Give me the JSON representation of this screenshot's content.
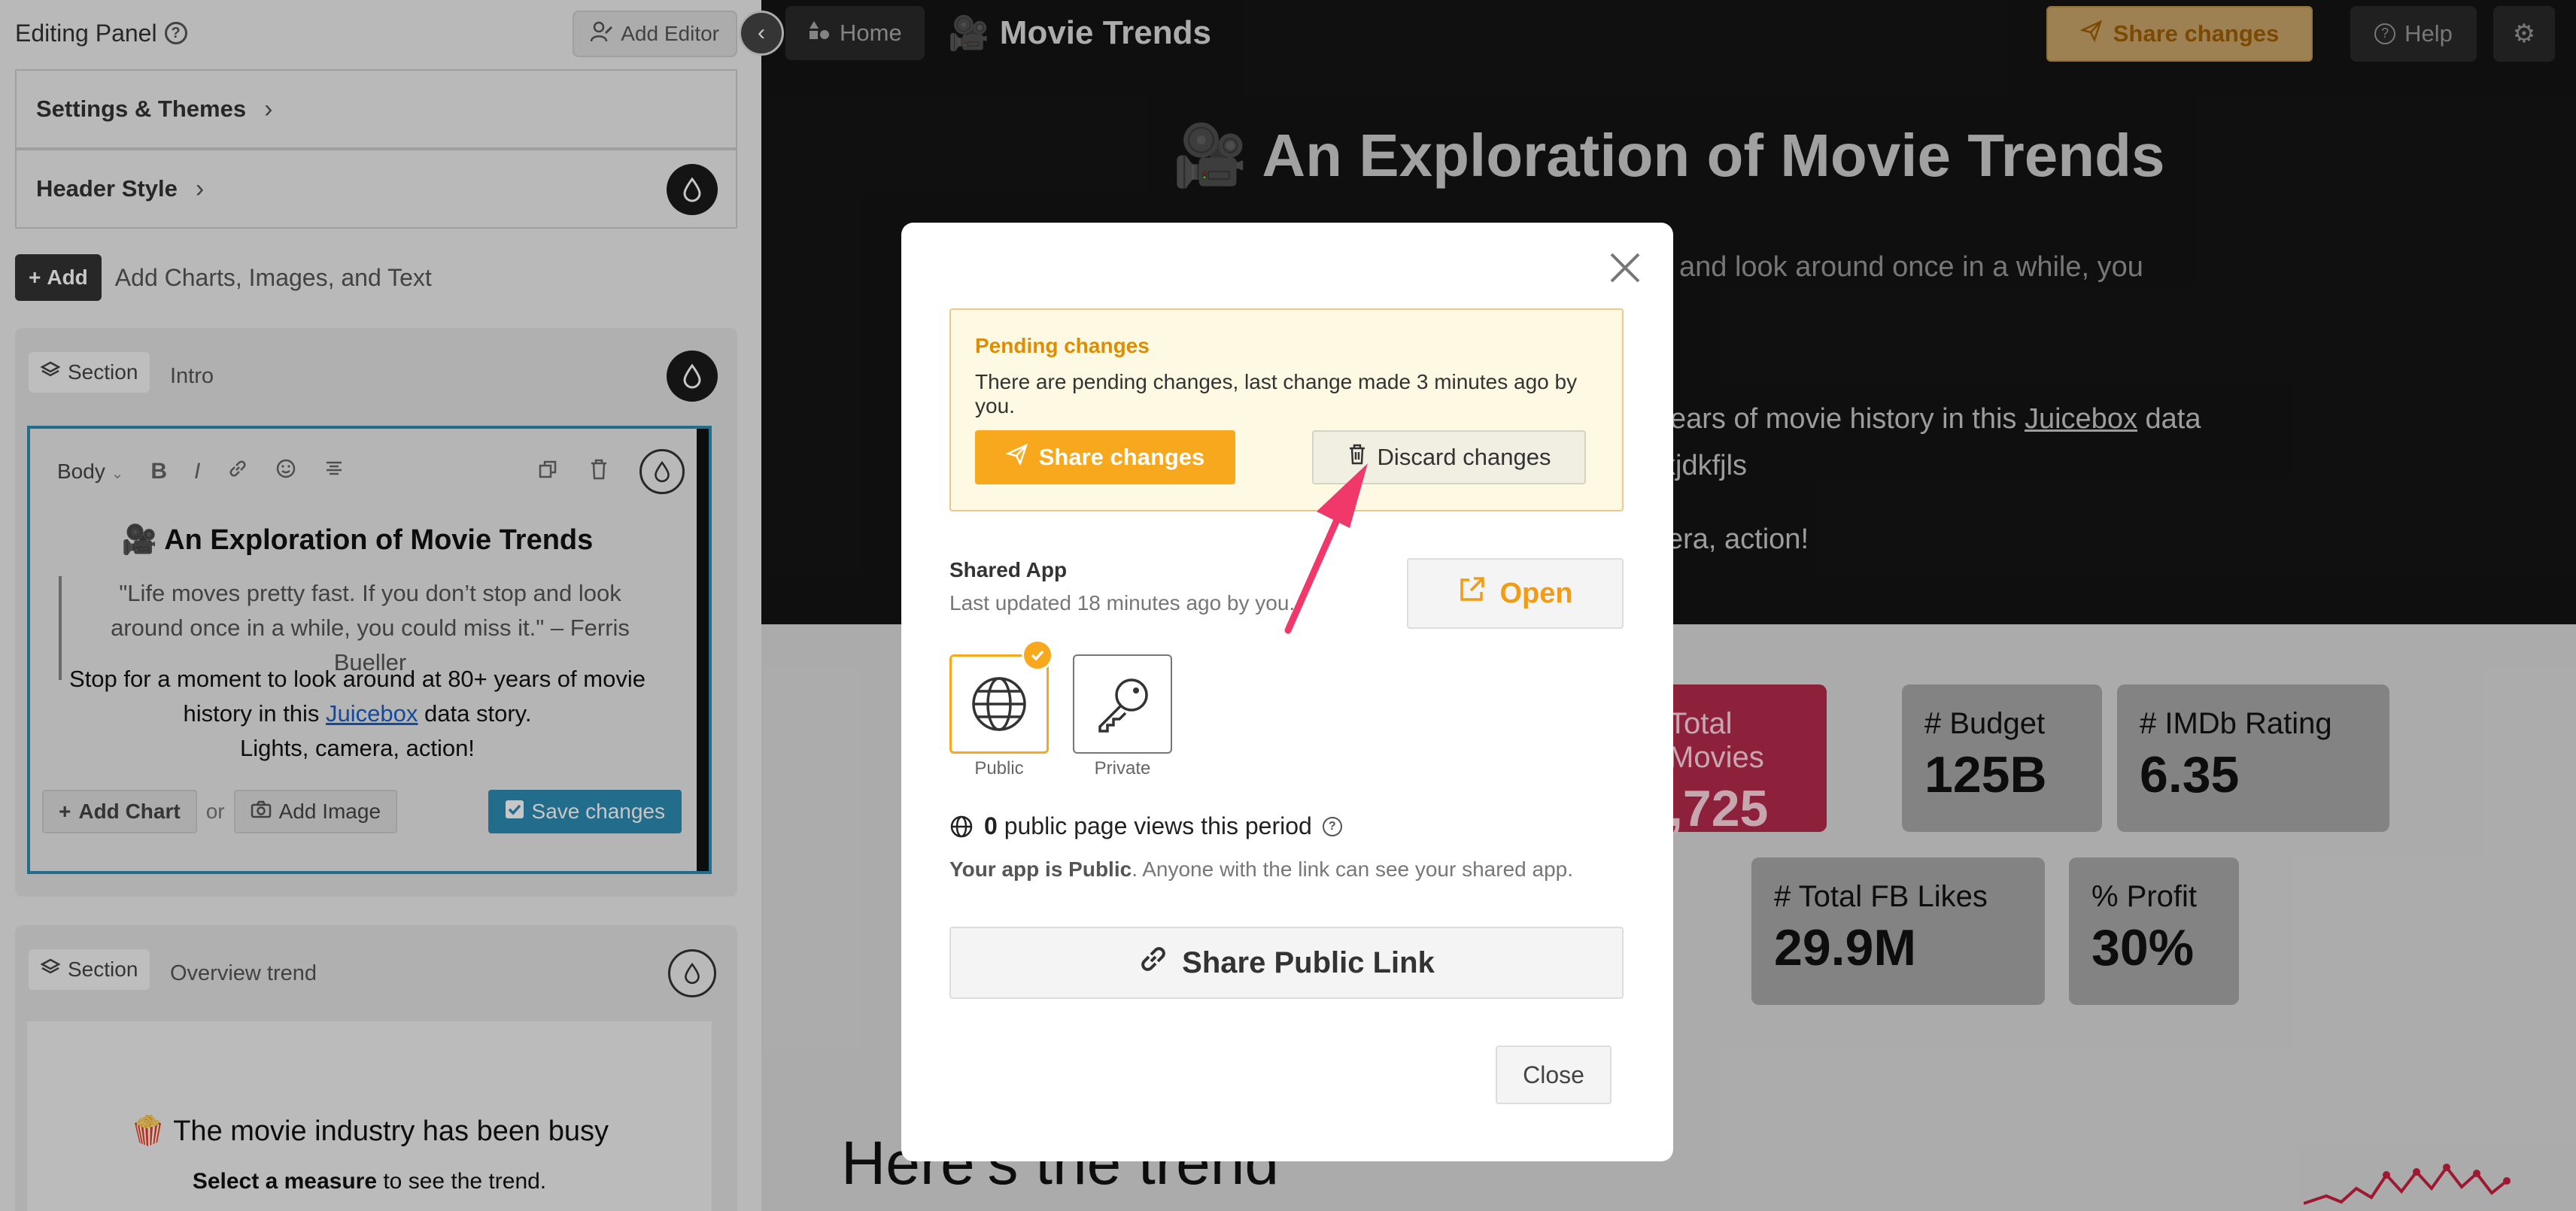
{
  "editing_panel": {
    "title": "Editing Panel",
    "add_editor_label": "Add Editor",
    "settings_label": "Settings & Themes",
    "header_style_label": "Header Style",
    "add_button_label": "Add",
    "add_text": "Add Charts, Images, and Text",
    "intro_section": {
      "chip_label": "Section",
      "name": "Intro",
      "editor": {
        "style_select": "Body",
        "title": "An Exploration of Movie Trends",
        "quote": "\"Life moves pretty fast. If you don’t stop and look around once in a while, you could miss it.\" – Ferris Bueller",
        "body_pre": "Stop for a moment to look around at 80+ years of movie history in this ",
        "body_link": "Juicebox",
        "body_post": " data story.",
        "body_line2": "Lights, camera, action!",
        "add_chart_label": "Add Chart",
        "or_label": "or",
        "add_image_label": "Add Image",
        "save_label": "Save changes"
      }
    },
    "overview_section": {
      "chip_label": "Section",
      "name": "Overview trend",
      "title": "The movie industry has been busy",
      "subtitle_bold": "Select a measure",
      "subtitle_rest": " to see the trend."
    }
  },
  "app": {
    "home_label": "Home",
    "title": "Movie Trends",
    "share_label": "Share changes",
    "help_label": "Help",
    "hero_title": "An Exploration of Movie Trends",
    "hero_line1": "and look around once in a while, you",
    "hero_line2_pre": "ears of movie history in this ",
    "hero_line2_link": "Juicebox",
    "hero_line2_post": " data",
    "hero_line3": "kjdkfjls",
    "hero_line4": "era, action!",
    "kpis": [
      {
        "label": "Total Movies",
        "value": ",725"
      },
      {
        "label": "# Budget",
        "value": "125B"
      },
      {
        "label": "# IMDb Rating",
        "value": "6.35"
      },
      {
        "label": "# Total FB Likes",
        "value": "29.9M"
      },
      {
        "label": "% Profit",
        "value": "30%"
      }
    ],
    "trend_heading": "Here’s the trend"
  },
  "modal": {
    "pending_title": "Pending changes",
    "pending_text": "There are pending changes, last change made 3 minutes ago by you.",
    "share_label": "Share changes",
    "discard_label": "Discard changes",
    "shared_app_title": "Shared App",
    "shared_app_sub": "Last updated 18 minutes ago by you.",
    "open_label": "Open",
    "public_label": "Public",
    "private_label": "Private",
    "views_count": "0",
    "views_text": "public page views this period",
    "public_note_bold": "Your app is Public",
    "public_note_rest": ". Anyone with the link can see your shared app.",
    "share_link_label": "Share Public Link",
    "close_label": "Close"
  },
  "colors": {
    "accent_orange": "#f7a81c",
    "pending_title": "#e08c00",
    "kpi_accent": "#b5294c",
    "editor_blue": "#2c8cb3",
    "annotation_arrow": "#f0386b"
  }
}
